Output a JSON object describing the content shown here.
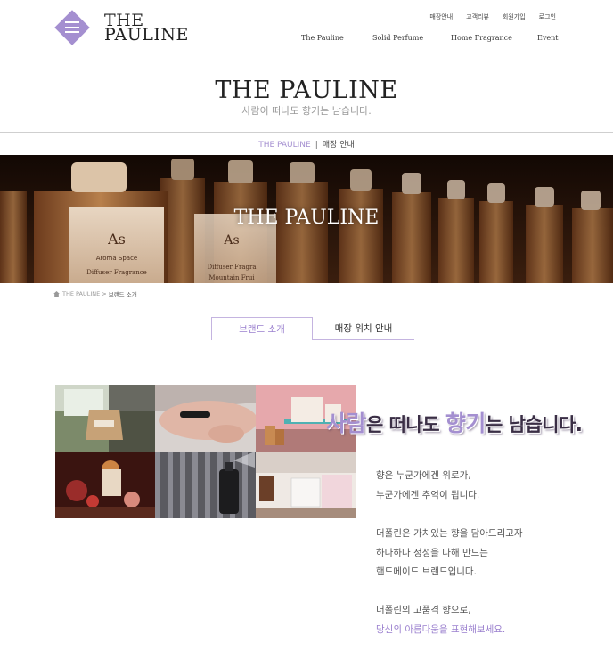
{
  "brand": {
    "logo_line1": "THE",
    "logo_line2": "PAULINE"
  },
  "util_links": [
    "매장안내",
    "고객리뷰",
    "회원가입",
    "로그인"
  ],
  "main_nav": [
    "The Pauline",
    "Solid Perfume",
    "Home Fragrance",
    "Event"
  ],
  "page_title": "THE PAULINE",
  "tagline": "사람이 떠나도 향기는 남습니다.",
  "sub_crumb": {
    "brand": "THE PAULINE",
    "separator": "|",
    "page": "매장 안내"
  },
  "hero": {
    "title": "THE PAULINE"
  },
  "breadcrumb": {
    "home": "THE PAULINE",
    "separator": ">",
    "current": "브랜드 소개"
  },
  "tabs": [
    {
      "label": "브랜드 소개",
      "active": true
    },
    {
      "label": "매장 위치 안내",
      "active": false
    }
  ],
  "headline": {
    "w1": "사람",
    "w2": "은 떠나도 ",
    "w3": "향기",
    "w4": "는 남습니다."
  },
  "paragraphs": [
    [
      "향은 누군가에겐 위로가,",
      "누군가에겐 추억이 됩니다."
    ],
    [
      "더폴린은 가치있는 향을 담아드리고자",
      "하나하나 정성을 다해 만드는",
      "핸드메이드 브랜드입니다."
    ],
    [
      "더폴린의 고품격 향으로,",
      "당신의 아름다움을 표현해보세요."
    ]
  ],
  "colors": {
    "accent": "#a48fd0",
    "text": "#333333"
  },
  "icons": {
    "menu": "hamburger-icon",
    "home": "home-icon"
  }
}
